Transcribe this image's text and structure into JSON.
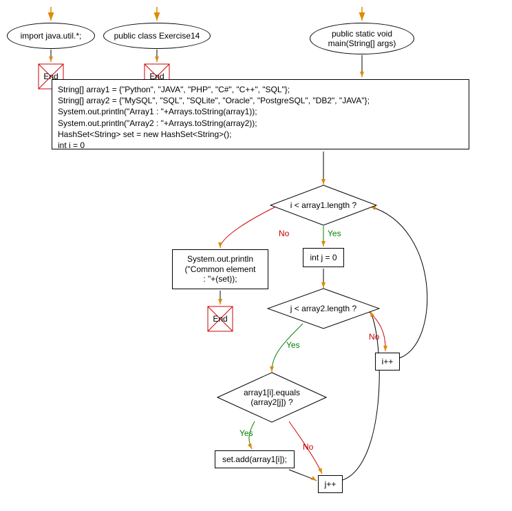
{
  "nodes": {
    "ellipse_import": "import java.util.*;",
    "ellipse_class": "public class Exercise14",
    "ellipse_main_l1": "public static void",
    "ellipse_main_l2": "main(String[] args)",
    "code_block": "String[] array1 = {\"Python\", \"JAVA\", \"PHP\", \"C#\", \"C++\", \"SQL\"};\nString[] array2 = {\"MySQL\", \"SQL\", \"SQLite\", \"Oracle\", \"PostgreSQL\", \"DB2\", \"JAVA\"};\nSystem.out.println(\"Array1 : \"+Arrays.toString(array1));\nSystem.out.println(\"Array2 : \"+Arrays.toString(array2));\nHashSet<String> set = new HashSet<String>();\nint i = 0",
    "decision_outer": "i < array1.length ?",
    "print_common_l1": "System.out.println",
    "print_common_l2": "(\"Common element ",
    "print_common_l3": ": \"+(set));",
    "init_j": "int j = 0",
    "decision_inner": "j < array2.length ?",
    "decision_equals_l1": "array1[i].equals",
    "decision_equals_l2": "(array2[j]) ?",
    "set_add": "set.add(array1[i]);",
    "i_inc": "i++",
    "j_inc": "j++",
    "end": "End"
  },
  "labels": {
    "yes": "Yes",
    "no": "No"
  },
  "chart_data": {
    "type": "flowchart",
    "nodes": [
      {
        "id": "import",
        "shape": "ellipse",
        "text": "import java.util.*;"
      },
      {
        "id": "class",
        "shape": "ellipse",
        "text": "public class Exercise14"
      },
      {
        "id": "main",
        "shape": "ellipse",
        "text": "public static void main(String[] args)"
      },
      {
        "id": "end_import",
        "shape": "terminator",
        "text": "End"
      },
      {
        "id": "end_class",
        "shape": "terminator",
        "text": "End"
      },
      {
        "id": "code",
        "shape": "rect",
        "text": "String[] array1 = {\"Python\", \"JAVA\", \"PHP\", \"C#\", \"C++\", \"SQL\"}; String[] array2 = {\"MySQL\", \"SQL\", \"SQLite\", \"Oracle\", \"PostgreSQL\", \"DB2\", \"JAVA\"}; System.out.println(\"Array1 : \"+Arrays.toString(array1)); System.out.println(\"Array2 : \"+Arrays.toString(array2)); HashSet<String> set = new HashSet<String>(); int i = 0"
      },
      {
        "id": "d_outer",
        "shape": "diamond",
        "text": "i < array1.length ?"
      },
      {
        "id": "print_common",
        "shape": "rect",
        "text": "System.out.println(\"Common element : \"+(set));"
      },
      {
        "id": "end_print",
        "shape": "terminator",
        "text": "End"
      },
      {
        "id": "init_j",
        "shape": "rect",
        "text": "int j = 0"
      },
      {
        "id": "d_inner",
        "shape": "diamond",
        "text": "j < array2.length ?"
      },
      {
        "id": "d_equals",
        "shape": "diamond",
        "text": "array1[i].equals(array2[j]) ?"
      },
      {
        "id": "set_add",
        "shape": "rect",
        "text": "set.add(array1[i]);"
      },
      {
        "id": "i_inc",
        "shape": "rect",
        "text": "i++"
      },
      {
        "id": "j_inc",
        "shape": "rect",
        "text": "j++"
      },
      {
        "id": "entry_import",
        "shape": "entry"
      },
      {
        "id": "entry_class",
        "shape": "entry"
      },
      {
        "id": "entry_main",
        "shape": "entry"
      }
    ],
    "edges": [
      {
        "from": "entry_import",
        "to": "import"
      },
      {
        "from": "entry_class",
        "to": "class"
      },
      {
        "from": "entry_main",
        "to": "main"
      },
      {
        "from": "import",
        "to": "end_import"
      },
      {
        "from": "class",
        "to": "end_class"
      },
      {
        "from": "main",
        "to": "code"
      },
      {
        "from": "code",
        "to": "d_outer"
      },
      {
        "from": "d_outer",
        "to": "init_j",
        "label": "Yes"
      },
      {
        "from": "d_outer",
        "to": "print_common",
        "label": "No"
      },
      {
        "from": "print_common",
        "to": "end_print"
      },
      {
        "from": "init_j",
        "to": "d_inner"
      },
      {
        "from": "d_inner",
        "to": "d_equals",
        "label": "Yes"
      },
      {
        "from": "d_inner",
        "to": "i_inc",
        "label": "No"
      },
      {
        "from": "i_inc",
        "to": "d_outer"
      },
      {
        "from": "d_equals",
        "to": "set_add",
        "label": "Yes"
      },
      {
        "from": "d_equals",
        "to": "j_inc",
        "label": "No"
      },
      {
        "from": "set_add",
        "to": "j_inc"
      },
      {
        "from": "j_inc",
        "to": "d_inner"
      }
    ]
  }
}
